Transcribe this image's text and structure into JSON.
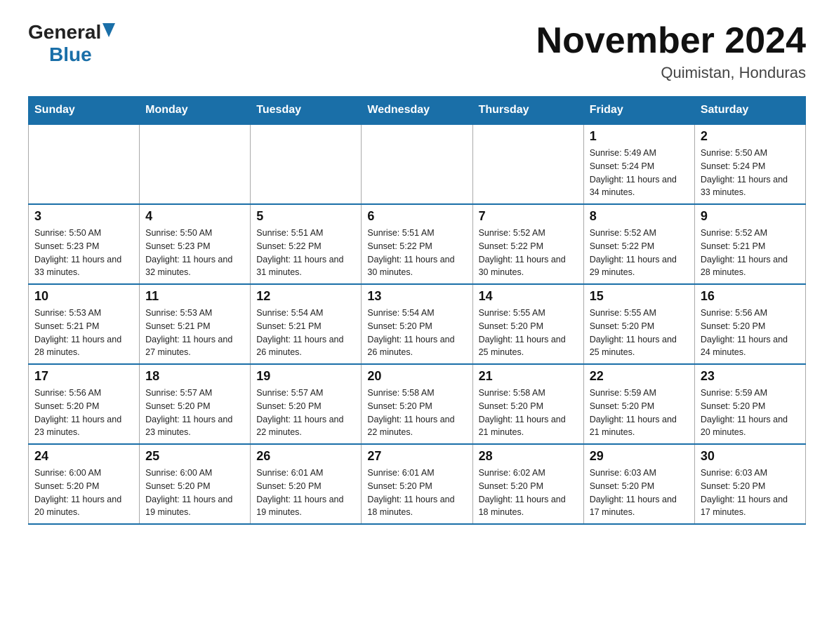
{
  "logo": {
    "general": "General",
    "blue": "Blue"
  },
  "title": {
    "month": "November 2024",
    "location": "Quimistan, Honduras"
  },
  "weekdays": [
    "Sunday",
    "Monday",
    "Tuesday",
    "Wednesday",
    "Thursday",
    "Friday",
    "Saturday"
  ],
  "weeks": [
    [
      {
        "day": "",
        "info": ""
      },
      {
        "day": "",
        "info": ""
      },
      {
        "day": "",
        "info": ""
      },
      {
        "day": "",
        "info": ""
      },
      {
        "day": "",
        "info": ""
      },
      {
        "day": "1",
        "info": "Sunrise: 5:49 AM\nSunset: 5:24 PM\nDaylight: 11 hours and 34 minutes."
      },
      {
        "day": "2",
        "info": "Sunrise: 5:50 AM\nSunset: 5:24 PM\nDaylight: 11 hours and 33 minutes."
      }
    ],
    [
      {
        "day": "3",
        "info": "Sunrise: 5:50 AM\nSunset: 5:23 PM\nDaylight: 11 hours and 33 minutes."
      },
      {
        "day": "4",
        "info": "Sunrise: 5:50 AM\nSunset: 5:23 PM\nDaylight: 11 hours and 32 minutes."
      },
      {
        "day": "5",
        "info": "Sunrise: 5:51 AM\nSunset: 5:22 PM\nDaylight: 11 hours and 31 minutes."
      },
      {
        "day": "6",
        "info": "Sunrise: 5:51 AM\nSunset: 5:22 PM\nDaylight: 11 hours and 30 minutes."
      },
      {
        "day": "7",
        "info": "Sunrise: 5:52 AM\nSunset: 5:22 PM\nDaylight: 11 hours and 30 minutes."
      },
      {
        "day": "8",
        "info": "Sunrise: 5:52 AM\nSunset: 5:22 PM\nDaylight: 11 hours and 29 minutes."
      },
      {
        "day": "9",
        "info": "Sunrise: 5:52 AM\nSunset: 5:21 PM\nDaylight: 11 hours and 28 minutes."
      }
    ],
    [
      {
        "day": "10",
        "info": "Sunrise: 5:53 AM\nSunset: 5:21 PM\nDaylight: 11 hours and 28 minutes."
      },
      {
        "day": "11",
        "info": "Sunrise: 5:53 AM\nSunset: 5:21 PM\nDaylight: 11 hours and 27 minutes."
      },
      {
        "day": "12",
        "info": "Sunrise: 5:54 AM\nSunset: 5:21 PM\nDaylight: 11 hours and 26 minutes."
      },
      {
        "day": "13",
        "info": "Sunrise: 5:54 AM\nSunset: 5:20 PM\nDaylight: 11 hours and 26 minutes."
      },
      {
        "day": "14",
        "info": "Sunrise: 5:55 AM\nSunset: 5:20 PM\nDaylight: 11 hours and 25 minutes."
      },
      {
        "day": "15",
        "info": "Sunrise: 5:55 AM\nSunset: 5:20 PM\nDaylight: 11 hours and 25 minutes."
      },
      {
        "day": "16",
        "info": "Sunrise: 5:56 AM\nSunset: 5:20 PM\nDaylight: 11 hours and 24 minutes."
      }
    ],
    [
      {
        "day": "17",
        "info": "Sunrise: 5:56 AM\nSunset: 5:20 PM\nDaylight: 11 hours and 23 minutes."
      },
      {
        "day": "18",
        "info": "Sunrise: 5:57 AM\nSunset: 5:20 PM\nDaylight: 11 hours and 23 minutes."
      },
      {
        "day": "19",
        "info": "Sunrise: 5:57 AM\nSunset: 5:20 PM\nDaylight: 11 hours and 22 minutes."
      },
      {
        "day": "20",
        "info": "Sunrise: 5:58 AM\nSunset: 5:20 PM\nDaylight: 11 hours and 22 minutes."
      },
      {
        "day": "21",
        "info": "Sunrise: 5:58 AM\nSunset: 5:20 PM\nDaylight: 11 hours and 21 minutes."
      },
      {
        "day": "22",
        "info": "Sunrise: 5:59 AM\nSunset: 5:20 PM\nDaylight: 11 hours and 21 minutes."
      },
      {
        "day": "23",
        "info": "Sunrise: 5:59 AM\nSunset: 5:20 PM\nDaylight: 11 hours and 20 minutes."
      }
    ],
    [
      {
        "day": "24",
        "info": "Sunrise: 6:00 AM\nSunset: 5:20 PM\nDaylight: 11 hours and 20 minutes."
      },
      {
        "day": "25",
        "info": "Sunrise: 6:00 AM\nSunset: 5:20 PM\nDaylight: 11 hours and 19 minutes."
      },
      {
        "day": "26",
        "info": "Sunrise: 6:01 AM\nSunset: 5:20 PM\nDaylight: 11 hours and 19 minutes."
      },
      {
        "day": "27",
        "info": "Sunrise: 6:01 AM\nSunset: 5:20 PM\nDaylight: 11 hours and 18 minutes."
      },
      {
        "day": "28",
        "info": "Sunrise: 6:02 AM\nSunset: 5:20 PM\nDaylight: 11 hours and 18 minutes."
      },
      {
        "day": "29",
        "info": "Sunrise: 6:03 AM\nSunset: 5:20 PM\nDaylight: 11 hours and 17 minutes."
      },
      {
        "day": "30",
        "info": "Sunrise: 6:03 AM\nSunset: 5:20 PM\nDaylight: 11 hours and 17 minutes."
      }
    ]
  ]
}
